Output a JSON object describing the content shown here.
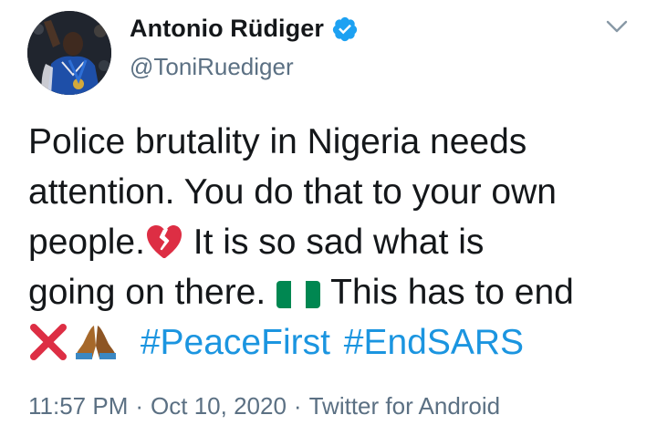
{
  "author": {
    "display_name": "Antonio Rüdiger",
    "handle": "@ToniRuediger",
    "verified": true
  },
  "tweet": {
    "lines": [
      [
        "Police brutality in Nigeria needs"
      ],
      [
        "attention. You do that to your own"
      ],
      [
        "people.",
        " It is so sad what is"
      ],
      [
        "going on there. ",
        " This has to end"
      ]
    ],
    "emoji_names": [
      "broken-heart-icon",
      "nigeria-flag-icon",
      "cross-mark-icon",
      "folded-hands-icon"
    ],
    "hashtags": [
      "#PeaceFirst",
      "#EndSARS"
    ]
  },
  "meta": {
    "time": "11:57 PM",
    "date": "Oct 10, 2020",
    "separator": "·",
    "source": "Twitter for Android"
  },
  "colors": {
    "text": "#14171a",
    "secondary": "#5b7083",
    "link": "#1b95e0",
    "verified": "#1da1f2"
  }
}
